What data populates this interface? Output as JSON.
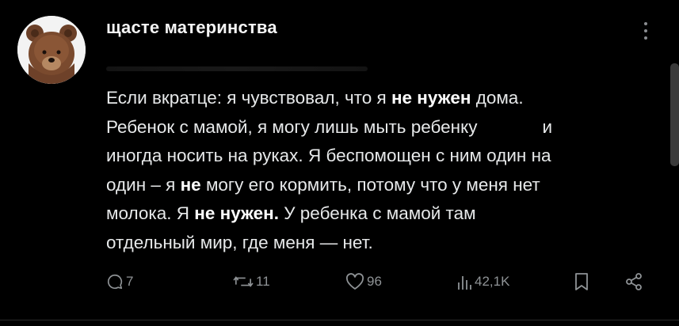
{
  "post": {
    "username": "щасте материнства",
    "text": {
      "l1_a": "Если вкратце: я чувствовал, что я ",
      "l1_b": "не нужен",
      "l1_c": " дома.",
      "l2_a": "Ребенок с мамой, я могу лишь мыть ребенку",
      "l2_b": "и",
      "l3": "иногда носить на руках. Я беспомощен с ним один на",
      "l4_a": "один – я ",
      "l4_b": "не",
      "l4_c": " могу его кормить, потому что у меня нет",
      "l5_a": "молока. Я ",
      "l5_b": "не нужен.",
      "l5_c": " У ребенка с мамой там",
      "l6": "отдельный мир, где меня — нет."
    }
  },
  "actions": {
    "replies": "7",
    "reposts": "11",
    "likes": "96",
    "views": "42,1K"
  },
  "icons": {
    "more": "more-vertical-icon",
    "reply": "comment-icon",
    "repost": "repost-icon",
    "like": "heart-icon",
    "views": "bar-chart-icon",
    "bookmark": "bookmark-icon",
    "share": "share-icon"
  },
  "colors": {
    "background": "#000000",
    "text": "#e7e9ea",
    "muted": "#8f9396"
  }
}
